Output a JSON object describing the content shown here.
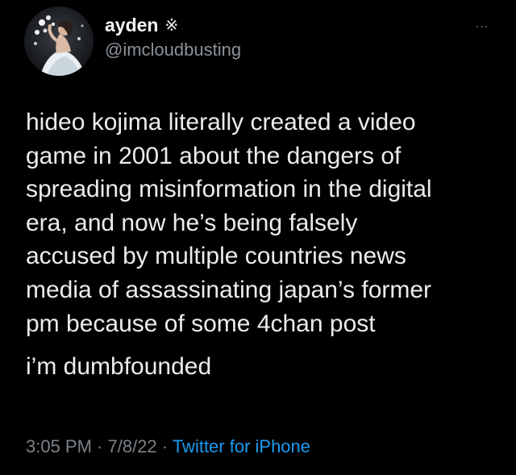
{
  "tweet": {
    "author": {
      "display_name": "ayden",
      "name_emoji": "※",
      "handle": "@imcloudbusting"
    },
    "more_icon": "more-dots-icon",
    "more_label": "···",
    "text_paragraphs": [
      "hideo kojima literally created a video\ngame in 2001 about the dangers of\nspreading misinformation in the digital\nera, and now he’s being falsely\naccused by multiple countries news\nmedia of assassinating japan’s former\npm because of some 4chan post",
      "i’m dumbfounded"
    ],
    "time": "3:05 PM",
    "separator": " · ",
    "date": "7/8/22",
    "source": "Twitter for iPhone"
  },
  "colors": {
    "background": "#000000",
    "text": "#ececec",
    "secondary": "#7b8288",
    "link": "#1d9bf0"
  }
}
